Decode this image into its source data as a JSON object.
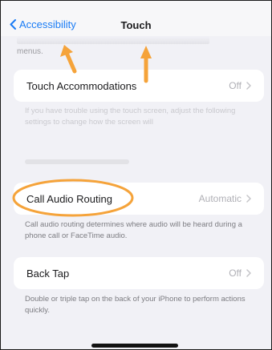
{
  "nav": {
    "back_label": "Accessibility",
    "title": "Touch"
  },
  "top_note": "menus.",
  "sections": {
    "touch_accommodations": {
      "label": "Touch Accommodations",
      "value": "Off",
      "footer": "If you have trouble using the touch screen, adjust the following settings to change how the screen will"
    },
    "call_audio_routing": {
      "label": "Call Audio Routing",
      "value": "Automatic",
      "footer": "Call audio routing determines where audio will be heard during a phone call or FaceTime audio."
    },
    "back_tap": {
      "label": "Back Tap",
      "value": "Off",
      "footer": "Double or triple tap on the back of your iPhone to perform actions quickly."
    }
  },
  "colors": {
    "accent": "#1a7cf5",
    "annotation": "#f5a33a",
    "background": "#f1f1f6"
  },
  "icons": {
    "back": "chevron-left-icon",
    "disclosure": "chevron-right-icon",
    "annotation_arrow": "arrow-up-icon",
    "annotation_circle": "highlight-ellipse"
  }
}
